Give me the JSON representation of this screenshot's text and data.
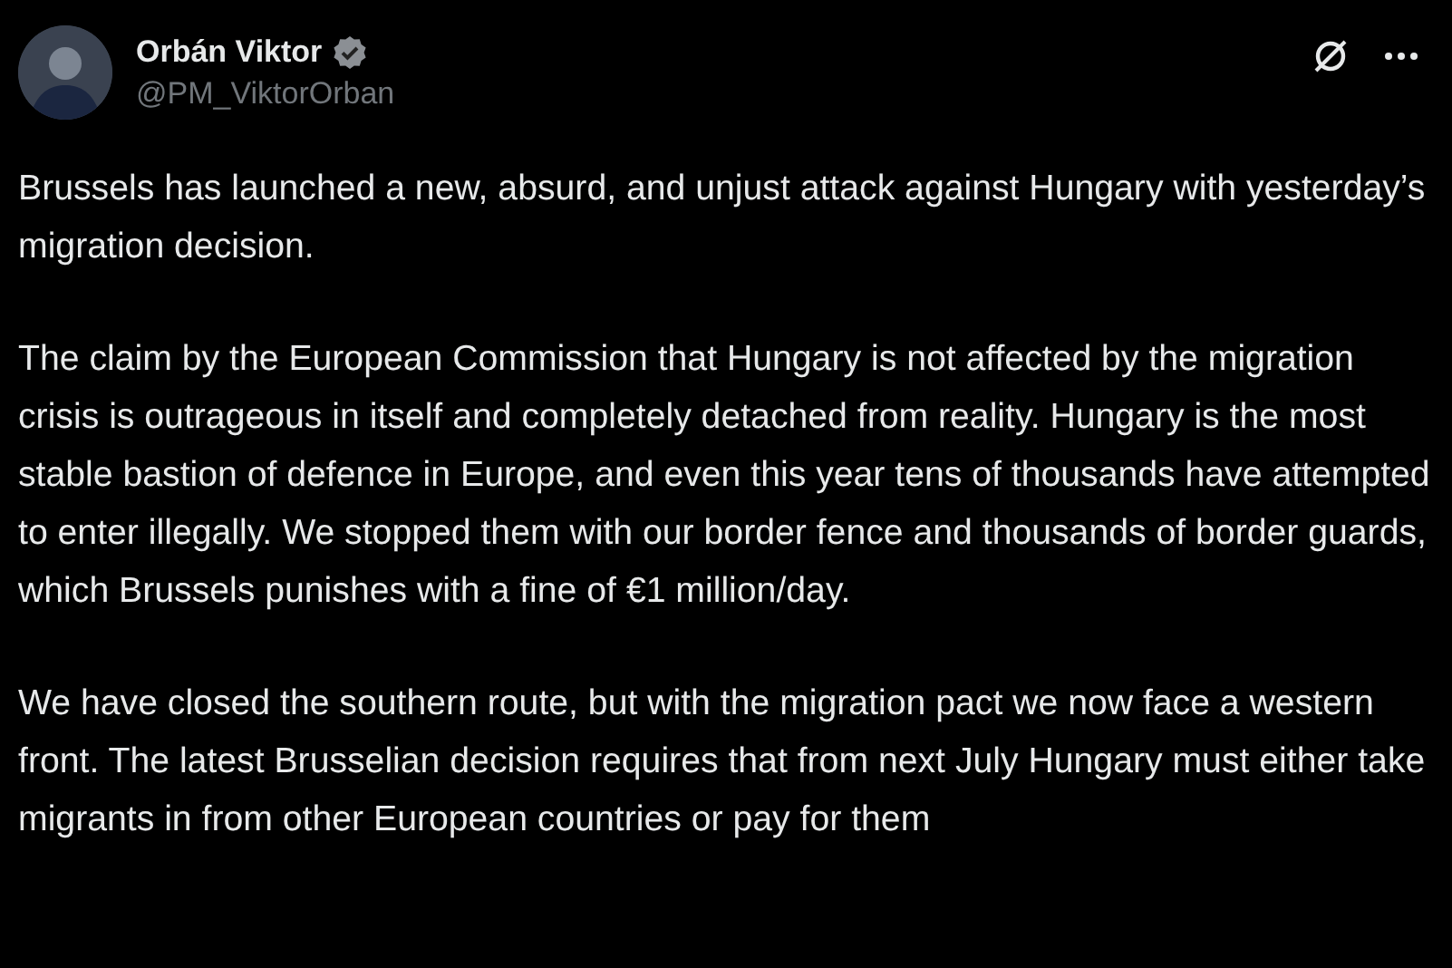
{
  "post": {
    "author_name": "Orbán Viktor",
    "verified": true,
    "handle": "@PM_ViktorOrban",
    "paragraphs": [
      "Brussels has launched a new, absurd, and unjust attack against Hungary with yesterday’s migration decision.",
      "The claim by the European Commission that Hungary is not affected by the migration crisis is outrageous in itself and completely detached from reality. Hungary is the most stable bastion of defence in Europe, and even this year tens of thousands have attempted to enter illegally. We stopped them with our border fence and thousands of border guards, which Brussels punishes with a fine of €1 million/day.",
      "We have closed the southern route, but with the migration pact we now face a western front. The latest Brusselian decision requires that from next July Hungary must either take migrants in from other European countries or pay for them"
    ]
  }
}
